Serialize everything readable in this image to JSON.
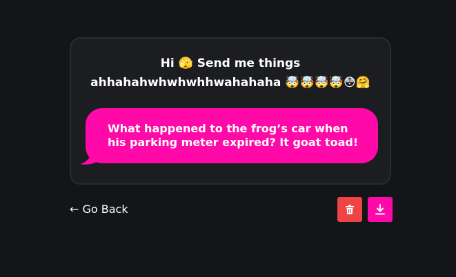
{
  "prompt": {
    "line1": "Hi 🫣 Send me things",
    "line2": "ahhahahwhwhwhhwahahaha 🤯🤯🤯🤯😳🤗"
  },
  "message": {
    "text": "What happened to the frog’s car when his parking meter expired? It goat toad!"
  },
  "nav": {
    "go_back_label": "← Go Back"
  },
  "actions": {
    "delete_icon": "trash-icon",
    "download_icon": "download-icon"
  },
  "colors": {
    "background": "#141518",
    "card": "#1c1d21",
    "accent": "#ff0aa8",
    "delete": "#ee4444"
  }
}
